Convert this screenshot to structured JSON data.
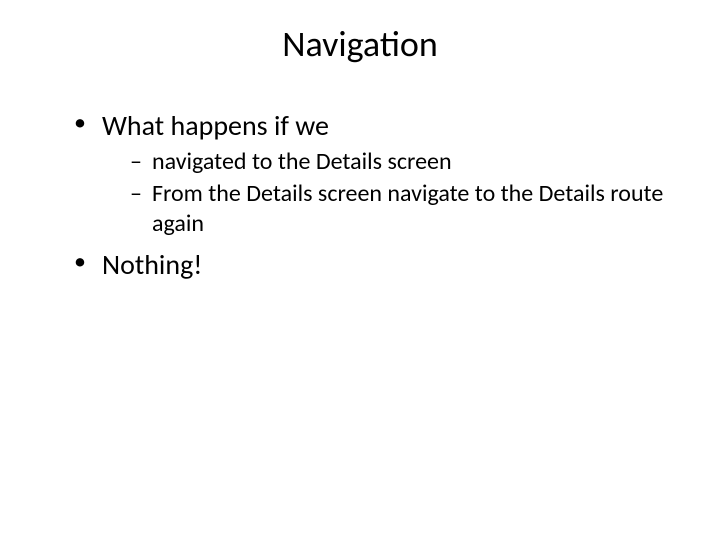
{
  "title": "Navigation",
  "bullets": {
    "item1": "What happens if we",
    "sub1": "navigated to the Details screen",
    "sub2": "From the Details screen navigate to the Details route again",
    "item2": "Nothing!"
  }
}
